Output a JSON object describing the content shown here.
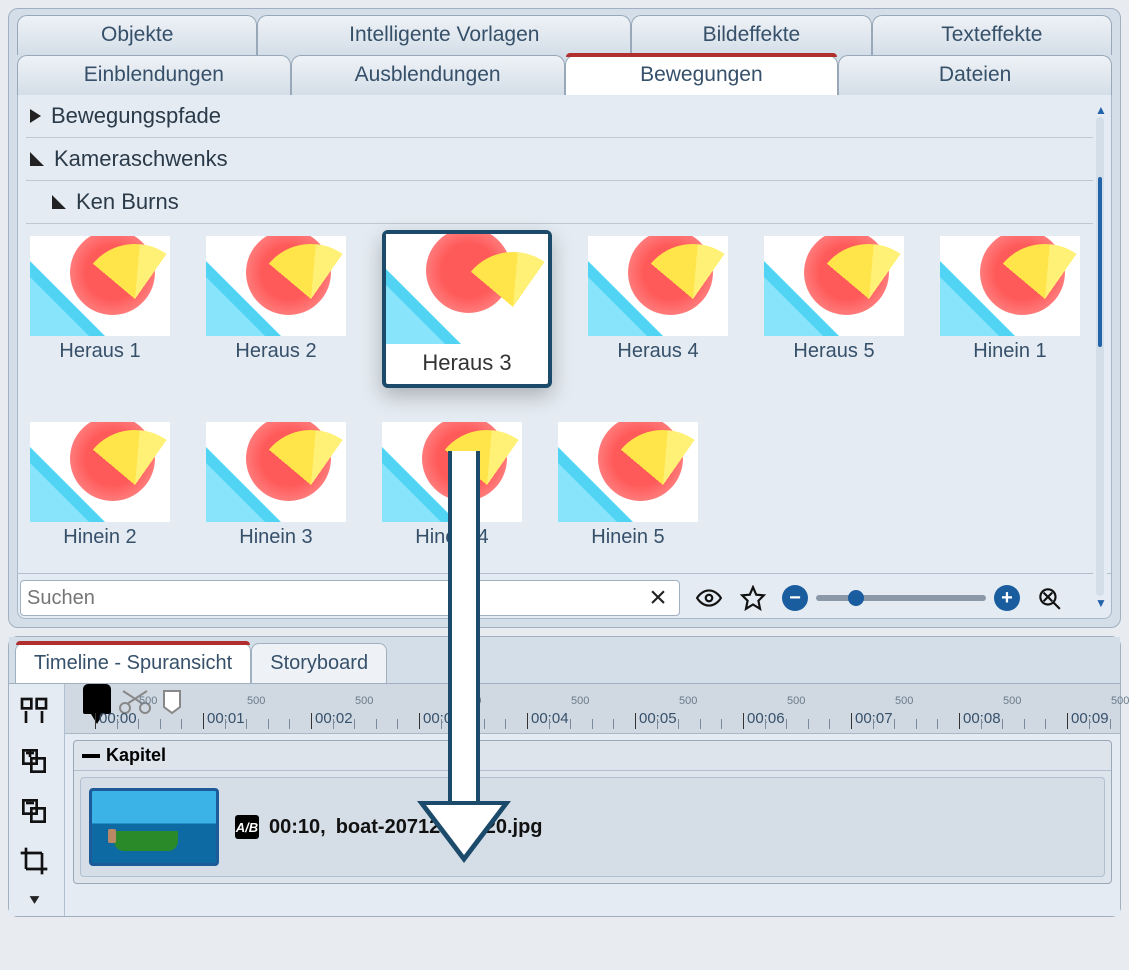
{
  "tabs_row1": [
    "Objekte",
    "Intelligente Vorlagen",
    "Bildeffekte",
    "Texteffekte"
  ],
  "tabs_row2": [
    "Einblendungen",
    "Ausblendungen",
    "Bewegungen",
    "Dateien"
  ],
  "tabs_row2_active_index": 2,
  "sections": {
    "paths": "Bewegungspfade",
    "pans": "Kameraschwenks",
    "kenburns": "Ken Burns"
  },
  "thumbs": [
    "Heraus 1",
    "Heraus 2",
    "Heraus 3",
    "Heraus 4",
    "Heraus 5",
    "Hinein 1",
    "Hinein 2",
    "Hinein 3",
    "Hinein 4",
    "Hinein 5"
  ],
  "selected_thumb_index": 2,
  "search": {
    "placeholder": "Suchen"
  },
  "timeline": {
    "tabs": [
      "Timeline - Spuransicht",
      "Storyboard"
    ],
    "active_tab_index": 0,
    "ruler_start": "00:00",
    "ruler_sub": "500",
    "seconds": [
      "00:00",
      "00:01",
      "00:02",
      "00:03",
      "00:04",
      "00:05",
      "00:06",
      "00:07",
      "00:08",
      "00:09"
    ],
    "chapter_label": "Kapitel",
    "clip": {
      "duration": "00:10,",
      "filename": "boat-207129_1920.jpg",
      "badge": "A/B"
    }
  },
  "icons": {
    "clear": "×",
    "eye": "eye",
    "star": "star",
    "minus": "−",
    "plus": "+",
    "reset": "reset"
  }
}
